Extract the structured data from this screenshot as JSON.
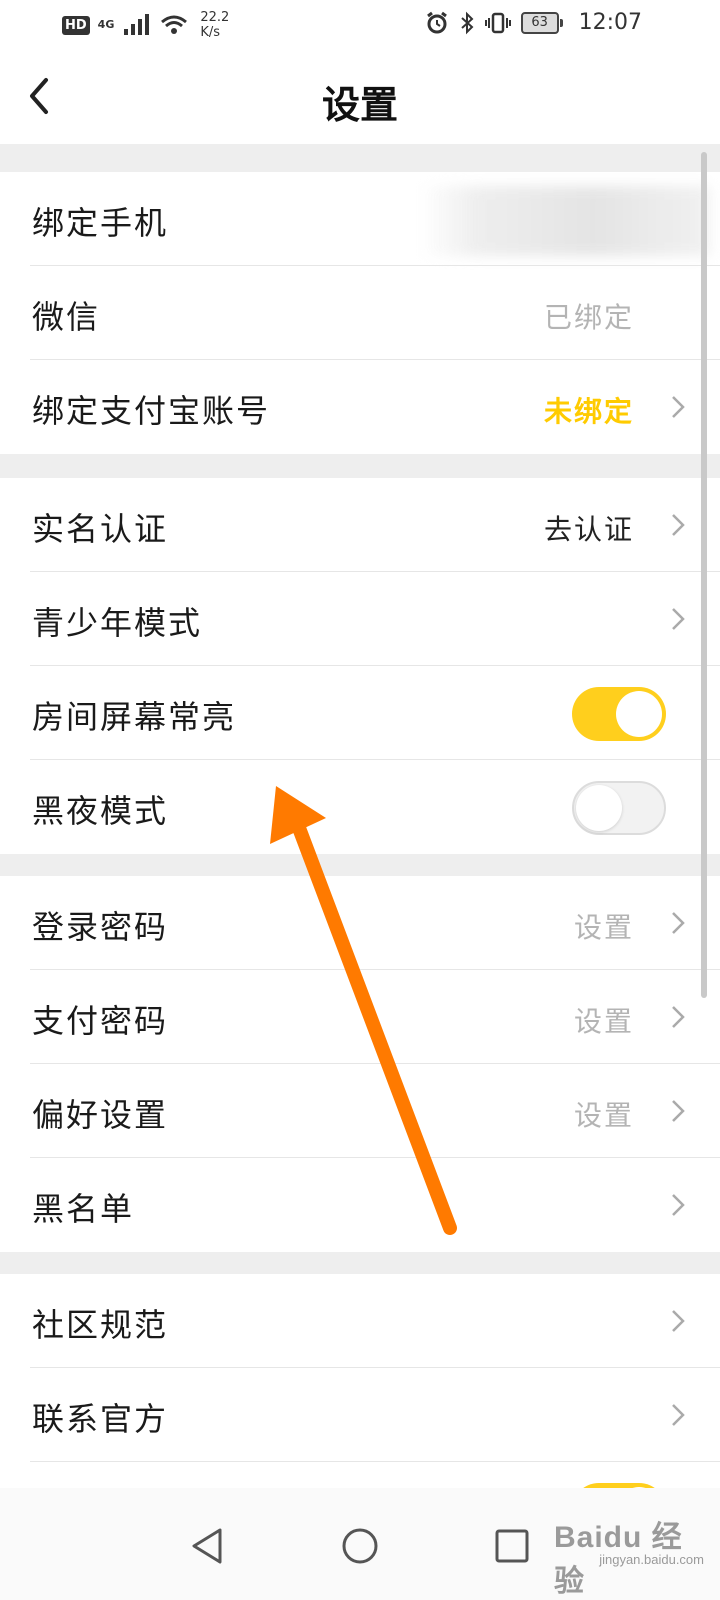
{
  "status_bar": {
    "hd": "HD",
    "network": "4G",
    "speed_value": "22.2",
    "speed_unit": "K/s",
    "battery": "63",
    "time": "12:07"
  },
  "header": {
    "title": "设置"
  },
  "groups": [
    {
      "rows": [
        {
          "label": "绑定手机",
          "value": ""
        },
        {
          "label": "微信",
          "value": "已绑定"
        },
        {
          "label": "绑定支付宝账号",
          "value": "未绑定"
        }
      ]
    },
    {
      "rows": [
        {
          "label": "实名认证",
          "value": "去认证"
        },
        {
          "label": "青少年模式",
          "value": ""
        },
        {
          "label": "房间屏幕常亮",
          "toggle": "on"
        },
        {
          "label": "黑夜模式",
          "toggle": "off"
        }
      ]
    },
    {
      "rows": [
        {
          "label": "登录密码",
          "value": "设置"
        },
        {
          "label": "支付密码",
          "value": "设置"
        },
        {
          "label": "偏好设置",
          "value": "设置"
        },
        {
          "label": "黑名单",
          "value": ""
        }
      ]
    },
    {
      "rows": [
        {
          "label": "社区规范",
          "value": ""
        },
        {
          "label": "联系官方",
          "value": ""
        },
        {
          "label": "",
          "toggle": "on"
        }
      ]
    }
  ],
  "colors": {
    "accent_yellow": "#ffcf1d",
    "annotation_orange": "#ff7a00"
  },
  "watermark": {
    "main": "Baidu 经验",
    "sub": "jingyan.baidu.com"
  }
}
